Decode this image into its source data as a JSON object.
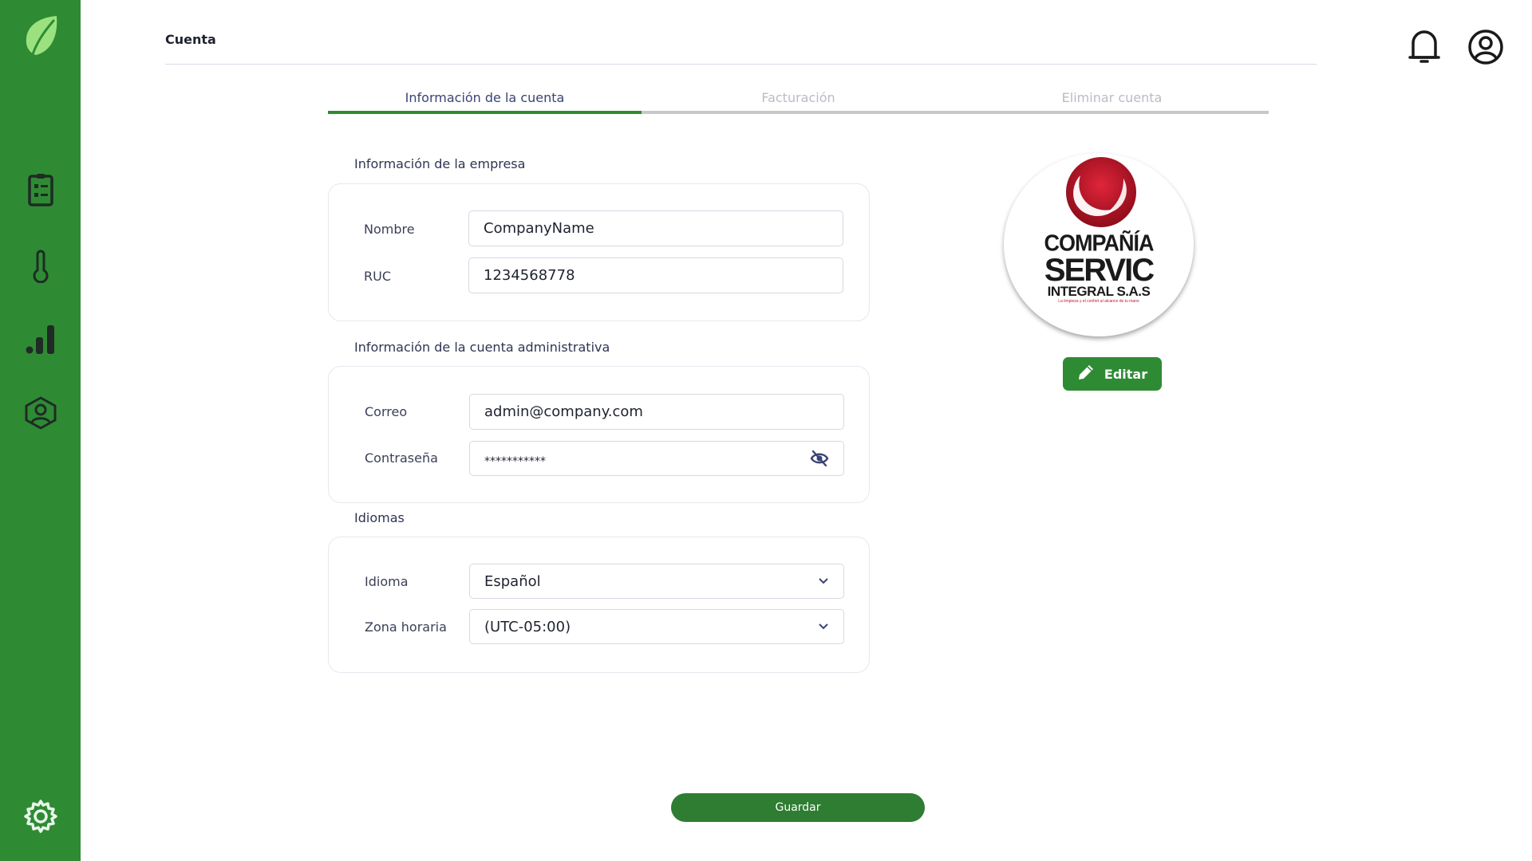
{
  "sidebar": {
    "logo_icon": "leaf-icon",
    "items": [
      {
        "id": "orders",
        "icon": "clipboard-checklist-icon"
      },
      {
        "id": "temperature",
        "icon": "thermometer-icon"
      },
      {
        "id": "statistics",
        "icon": "bar-chart-icon"
      },
      {
        "id": "profile",
        "icon": "user-badge-icon"
      }
    ],
    "settings_icon": "gear-icon",
    "background": "#2e8b34"
  },
  "header": {
    "title": "Cuenta",
    "notification_icon": "bell-icon",
    "user_icon": "user-circle-icon"
  },
  "tabs": [
    {
      "label": "Información de la cuenta",
      "active": true
    },
    {
      "label": "Facturación",
      "active": false
    },
    {
      "label": "Eliminar cuenta",
      "active": false
    }
  ],
  "company_section": {
    "title": "Información de la empresa",
    "name_label": "Nombre",
    "name_value": "CompanyName",
    "ruc_label": "RUC",
    "ruc_value": "1234568778"
  },
  "admin_section": {
    "title": "Información de la cuenta administrativa",
    "email_label": "Correo",
    "email_value": "admin@company.com",
    "password_label": "Contraseña",
    "password_value": "***********"
  },
  "language_section": {
    "title": "Idiomas",
    "language_label": "Idioma",
    "language_value": "Español",
    "timezone_label": "Zona horaria",
    "timezone_value": "(UTC-05:00)"
  },
  "company_logo": {
    "line1": "COMPAÑÍA",
    "line2": "SERVIC",
    "line3": "INTEGRAL S.A.S",
    "tagline": "La limpieza y el confort al alcance de tu mano"
  },
  "edit_button": {
    "label": "Editar"
  },
  "save_button": {
    "label": "Guardar"
  },
  "colors": {
    "primary": "#2e8b34",
    "active_tab_text": "#3a4473",
    "inactive_tab_text": "#b9bcc4"
  }
}
